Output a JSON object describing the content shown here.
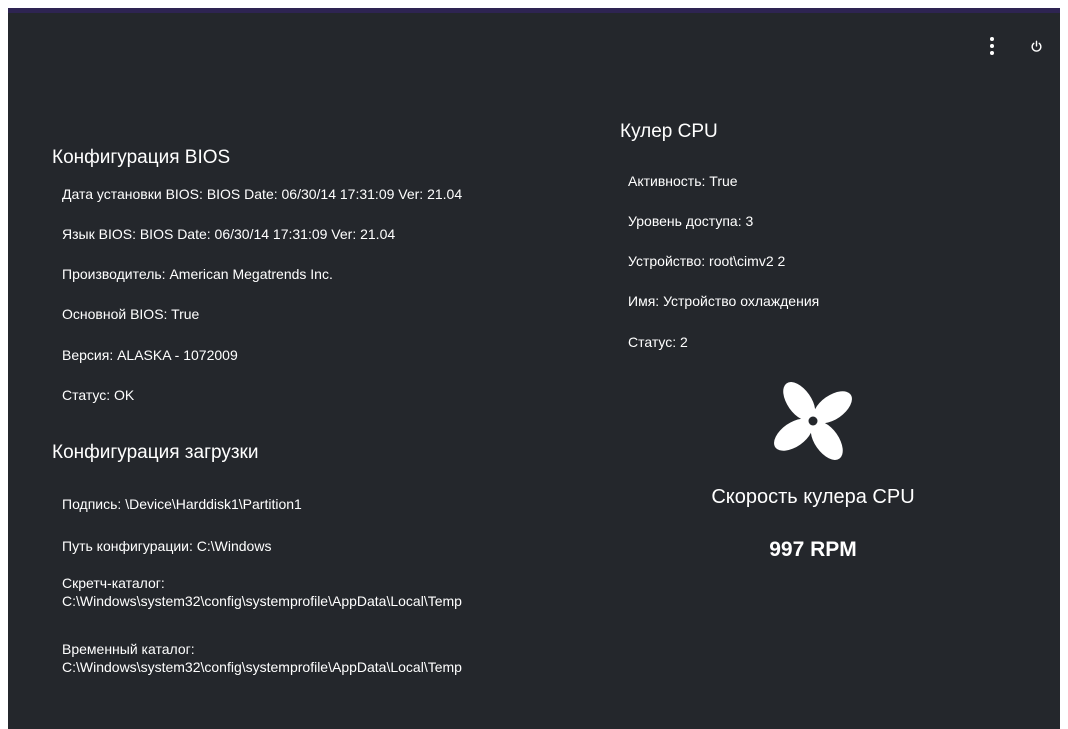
{
  "toolbar": {
    "menu_icon": "more-vertical-icon",
    "power_icon": "power-icon"
  },
  "bios": {
    "title": "Конфигурация BIOS",
    "fields": [
      {
        "label": "Дата установки BIOS",
        "value": "BIOS Date: 06/30/14 17:31:09 Ver: 21.04"
      },
      {
        "label": "Язык BIOS",
        "value": "BIOS Date: 06/30/14 17:31:09 Ver: 21.04"
      },
      {
        "label": "Производитель",
        "value": "American Megatrends Inc."
      },
      {
        "label": "Основной BIOS",
        "value": "True"
      },
      {
        "label": "Версия",
        "value": "ALASKA - 1072009"
      },
      {
        "label": "Статус",
        "value": "OK"
      }
    ]
  },
  "boot": {
    "title": "Конфигурация загрузки",
    "fields": [
      {
        "label": "Подпись",
        "value": "\\Device\\Harddisk1\\Partition1"
      },
      {
        "label": "Путь конфигурации",
        "value": "C:\\Windows"
      },
      {
        "label": "Скретч-каталог:",
        "value": "C:\\Windows\\system32\\config\\systemprofile\\AppData\\Local\\Temp"
      },
      {
        "label": "Временный каталог:",
        "value": "C:\\Windows\\system32\\config\\systemprofile\\AppData\\Local\\Temp"
      }
    ]
  },
  "cooler": {
    "title": "Кулер CPU",
    "fields": [
      {
        "label": "Активность",
        "value": "True"
      },
      {
        "label": "Уровень доступа",
        "value": "3"
      },
      {
        "label": "Устройство",
        "value": "root\\cimv2 2"
      },
      {
        "label": "Имя",
        "value": "Устройство охлаждения"
      },
      {
        "label": "Статус",
        "value": "2"
      }
    ],
    "fan_icon": "fan-icon",
    "speed_label": "Скорость кулера CPU",
    "speed_value": "997 RPM"
  }
}
